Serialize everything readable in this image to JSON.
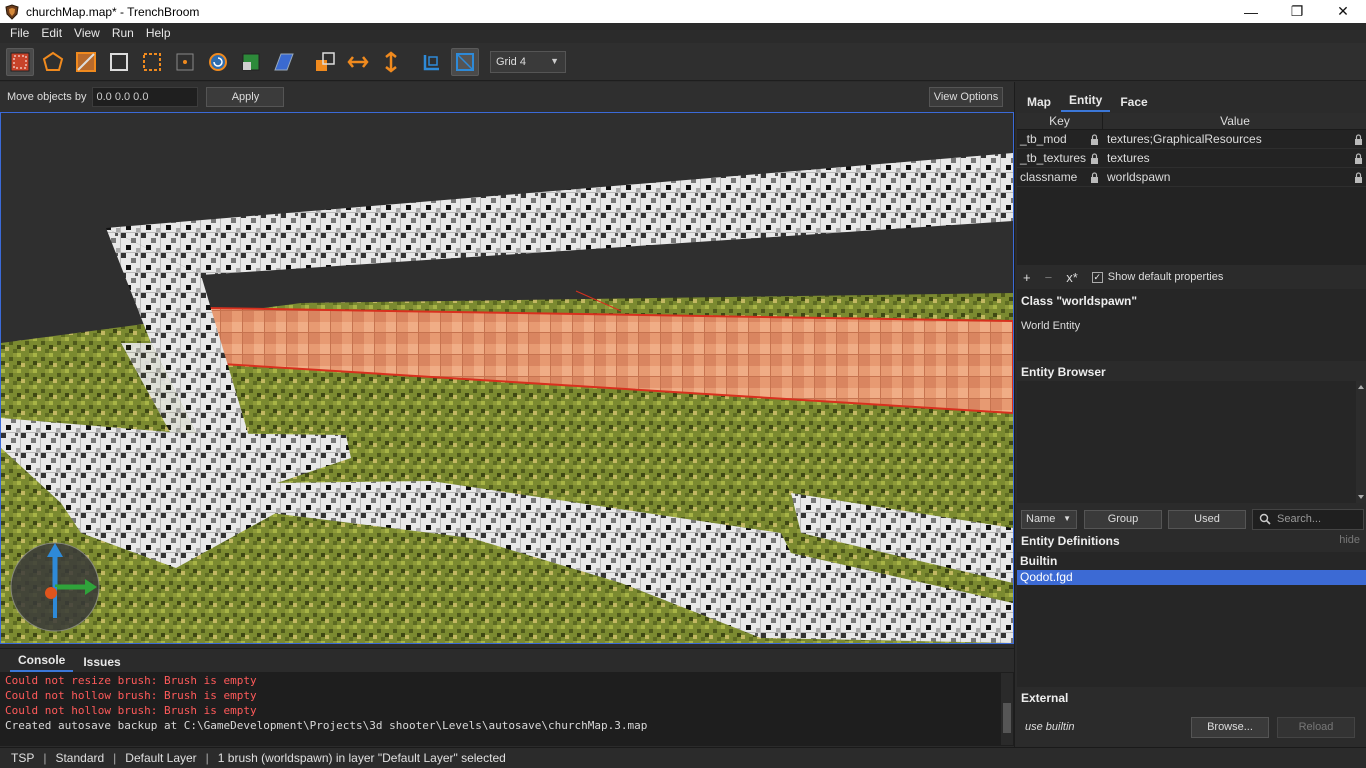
{
  "window": {
    "title": "churchMap.map* - TrenchBroom",
    "minimize": "—",
    "maximize": "❐",
    "close": "✕"
  },
  "menu": [
    "File",
    "Edit",
    "View",
    "Run",
    "Help"
  ],
  "toolbar": {
    "tools": [
      "brush-tool-icon",
      "vertex-tool-icon",
      "edge-tool-icon",
      "face-tool-icon",
      "clip-tool-icon",
      "point-tool-icon",
      "rotate-tool-icon",
      "scale-tool-icon",
      "shear-tool-icon",
      "duplicate-icon",
      "flip-horizontal-icon",
      "flip-vertical-icon",
      "texture-lock-icon",
      "uv-lock-icon"
    ],
    "grid_label": "Grid 4"
  },
  "movebar": {
    "label": "Move objects by",
    "value": "0.0 0.0 0.0",
    "apply": "Apply",
    "view_options": "View Options"
  },
  "console": {
    "tabs": [
      "Console",
      "Issues"
    ],
    "lines": [
      {
        "text": "Could not resize brush: Brush is empty",
        "type": "error"
      },
      {
        "text": "Could not hollow brush: Brush is empty",
        "type": "error"
      },
      {
        "text": "Could not hollow brush: Brush is empty",
        "type": "error"
      },
      {
        "text": "Created autosave backup at C:\\GameDevelopment\\Projects\\3d shooter\\Levels\\autosave\\churchMap.3.map",
        "type": "info"
      }
    ]
  },
  "status": {
    "items": [
      "TSP",
      "Standard",
      "Default Layer",
      "1 brush (worldspawn) in layer \"Default Layer\" selected"
    ]
  },
  "inspector": {
    "tabs": [
      "Map",
      "Entity",
      "Face"
    ],
    "active_tab": "Entity",
    "columns": {
      "key": "Key",
      "value": "Value"
    },
    "properties": [
      {
        "key": "_tb_mod",
        "value": "textures;GraphicalResources"
      },
      {
        "key": "_tb_textures",
        "value": "textures"
      },
      {
        "key": "classname",
        "value": "worldspawn"
      }
    ],
    "tools": {
      "add": "+",
      "remove": "−",
      "set_default": "x*",
      "show_default_label": "Show default properties",
      "show_default_checked": "✓"
    },
    "class_name": "Class \"worldspawn\"",
    "class_desc": "World Entity",
    "entity_browser": {
      "title": "Entity Browser",
      "sort": "Name",
      "group": "Group",
      "used": "Used",
      "search_placeholder": "Search..."
    },
    "entity_definitions": {
      "title": "Entity Definitions",
      "hide": "hide",
      "builtin_label": "Builtin",
      "items": [
        "Qodot.fgd"
      ],
      "external_label": "External",
      "external_value": "use builtin",
      "browse": "Browse...",
      "reload": "Reload"
    }
  },
  "colors": {
    "accent": "#3c6ad4",
    "error_text": "#ff5a5a",
    "tool_orange": "#f08a1e",
    "tool_blue": "#2e8ad8"
  }
}
